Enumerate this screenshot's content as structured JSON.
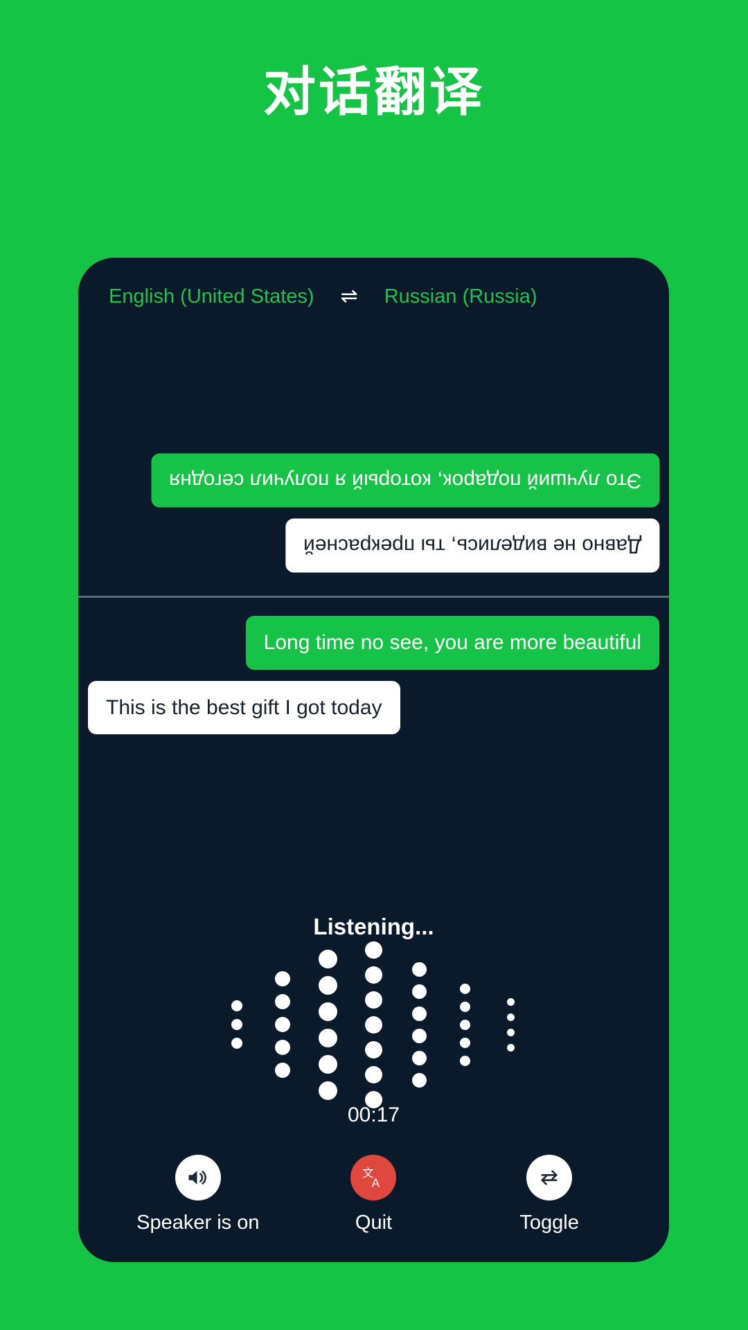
{
  "header": {
    "title": "对话翻译"
  },
  "colors": {
    "background_green": "#15c444",
    "card_dark": "#0b1a2b",
    "bubble_green": "#17c248",
    "bubble_white": "#ffffff",
    "accent_red": "#e0473f",
    "lang_text_green": "#1fc44a",
    "divider_grey": "#5b6b7a"
  },
  "language_bar": {
    "source_language": "English (United States)",
    "swap_icon": "swap-horizontal-icon",
    "swap_glyph": "⇌",
    "target_language": "Russian (Russia)"
  },
  "conversation": {
    "top_panel": {
      "rotated": true,
      "messages": [
        {
          "text": "Это лучший подарок, который я получил сегодня",
          "style": "green",
          "align": "right"
        },
        {
          "text": "Давно не виделись, ты прекрасней",
          "style": "white",
          "align": "right"
        }
      ]
    },
    "bottom_panel": {
      "rotated": false,
      "messages": [
        {
          "text": "Long time no see, you are more beautiful",
          "style": "green",
          "align": "right"
        },
        {
          "text": "This is the best gift I got today",
          "style": "white",
          "align": "left"
        }
      ]
    }
  },
  "listening": {
    "status_text": "Listening...",
    "timer": "00:17",
    "waveform": {
      "columns": [
        {
          "dots": 3,
          "size": 16
        },
        {
          "dots": 5,
          "size": 22
        },
        {
          "dots": 6,
          "size": 27
        },
        {
          "dots": 7,
          "size": 25
        },
        {
          "dots": 6,
          "size": 21
        },
        {
          "dots": 5,
          "size": 15
        },
        {
          "dots": 4,
          "size": 11
        }
      ]
    }
  },
  "controls": [
    {
      "label": "Speaker is on",
      "icon": "speaker-on-icon",
      "circle_style": "light",
      "name": "speaker-button"
    },
    {
      "label": "Quit",
      "icon": "translate-icon",
      "circle_style": "red",
      "name": "quit-button"
    },
    {
      "label": "Toggle",
      "icon": "swap-arrows-icon",
      "circle_style": "light",
      "name": "toggle-button"
    }
  ]
}
